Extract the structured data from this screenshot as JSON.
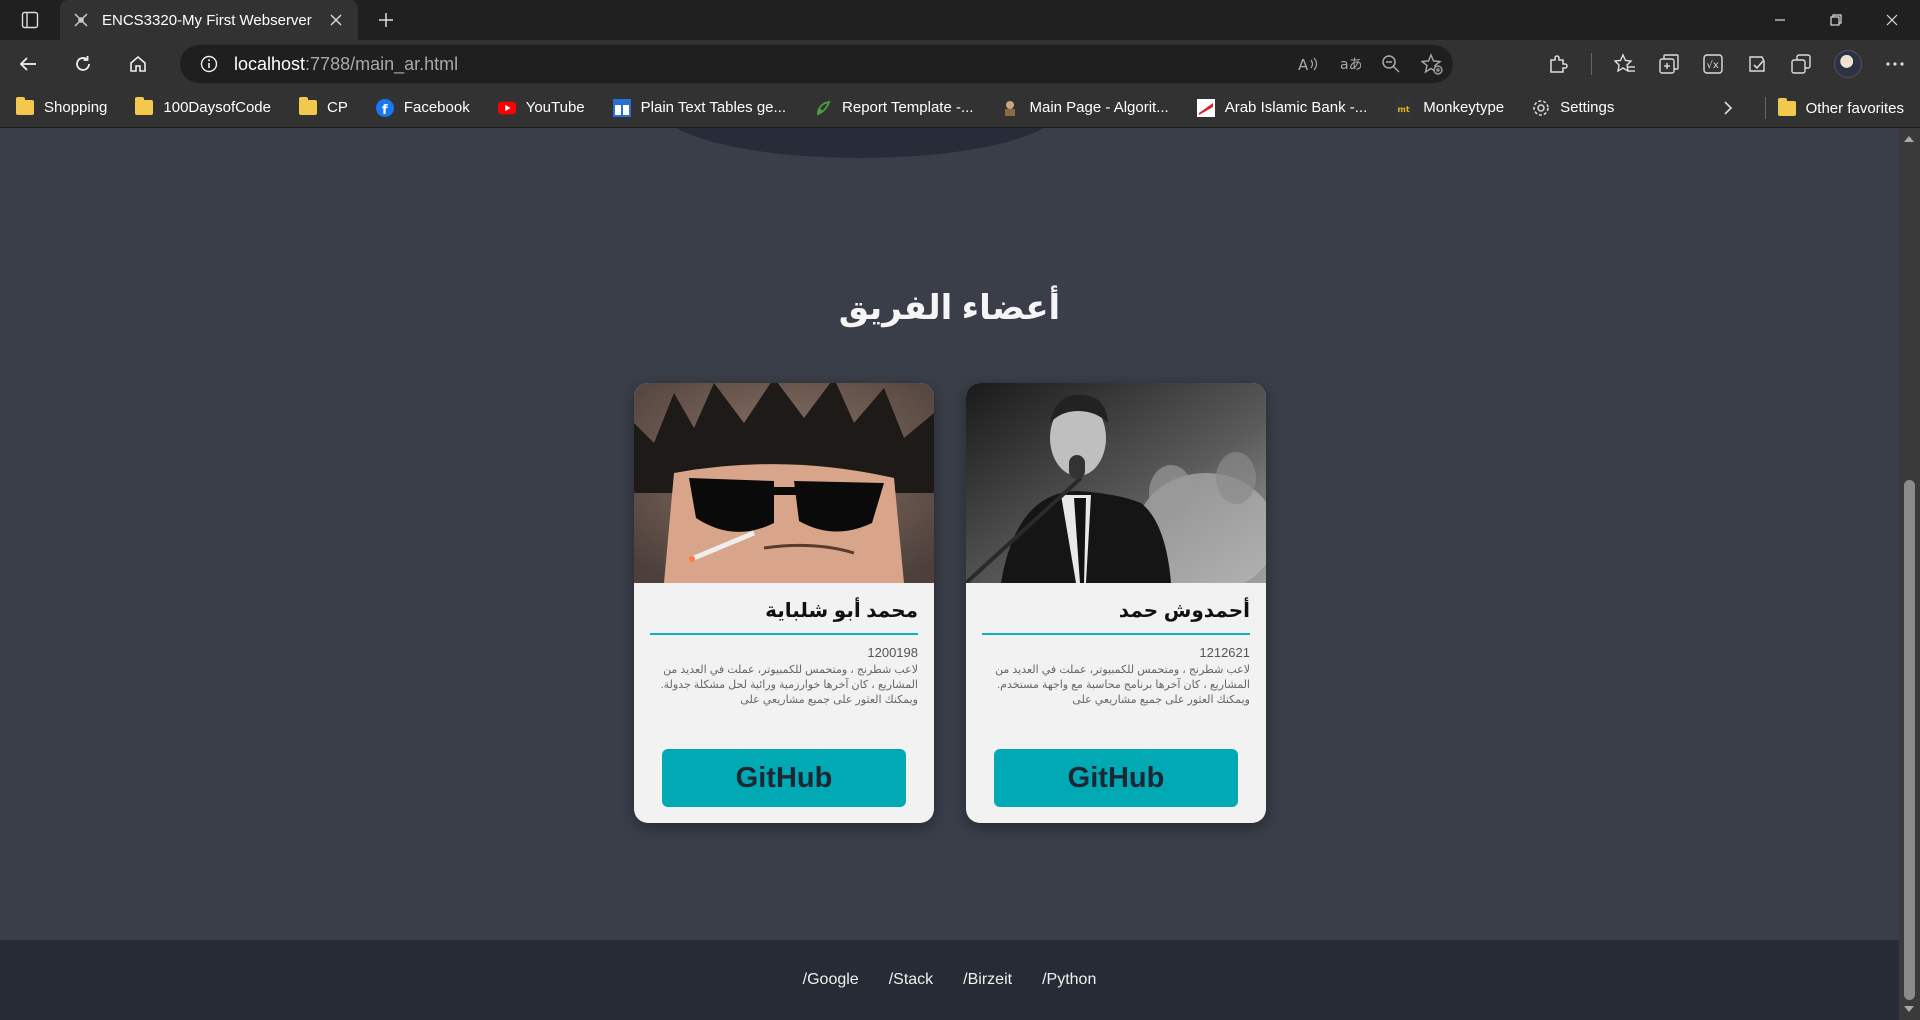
{
  "browser": {
    "tab_title": "ENCS3320-My First Webserver",
    "url_host": "localhost",
    "url_path": ":7788/main_ar.html",
    "bookmarks": [
      {
        "label": "Shopping",
        "icon": "folder-icon"
      },
      {
        "label": "100DaysofCode",
        "icon": "folder-icon"
      },
      {
        "label": "CP",
        "icon": "folder-icon"
      },
      {
        "label": "Facebook",
        "icon": "facebook-icon"
      },
      {
        "label": "YouTube",
        "icon": "youtube-icon"
      },
      {
        "label": "Plain Text Tables ge...",
        "icon": "tables-icon"
      },
      {
        "label": "Report Template -...",
        "icon": "overleaf-icon"
      },
      {
        "label": "Main Page - Algorit...",
        "icon": "algorithmica-icon"
      },
      {
        "label": "Arab Islamic Bank -...",
        "icon": "bank-icon"
      },
      {
        "label": "Monkeytype",
        "icon": "monkeytype-icon"
      },
      {
        "label": "Settings",
        "icon": "gear-icon"
      }
    ],
    "other_favorites": "Other favorites"
  },
  "page": {
    "section_title": "أعضاء الفريق",
    "members": [
      {
        "name": "محمد أبو شلباية",
        "id": "1200198",
        "desc": "لاعب شطرنج ، ومتحمس للكمبيوتر، عملت في العديد من المشاريع ، كان آخرها خوارزمية ورائية لحل مشكلة جدولة. ويمكنك العثور على جميع مشاريعي على",
        "button": "GitHub"
      },
      {
        "name": "أحمدوش حمد",
        "id": "1212621",
        "desc": "لاعب شطرنج ، ومتحمس للكمبيوتر، عملت في العديد من المشاريع ، كان آخرها برنامج محاسبة مع واجهة مستخدم. ويمكنك العثور على جميع مشاريعي على",
        "button": "GitHub"
      }
    ],
    "footer_links": [
      "/Google",
      "/Stack",
      "/Birzeit",
      "/Python"
    ]
  },
  "colors": {
    "page_bg": "#3a3e49",
    "footer_bg": "#262b35",
    "accent": "#00a9b4",
    "card_bg": "#f2f2f2"
  }
}
